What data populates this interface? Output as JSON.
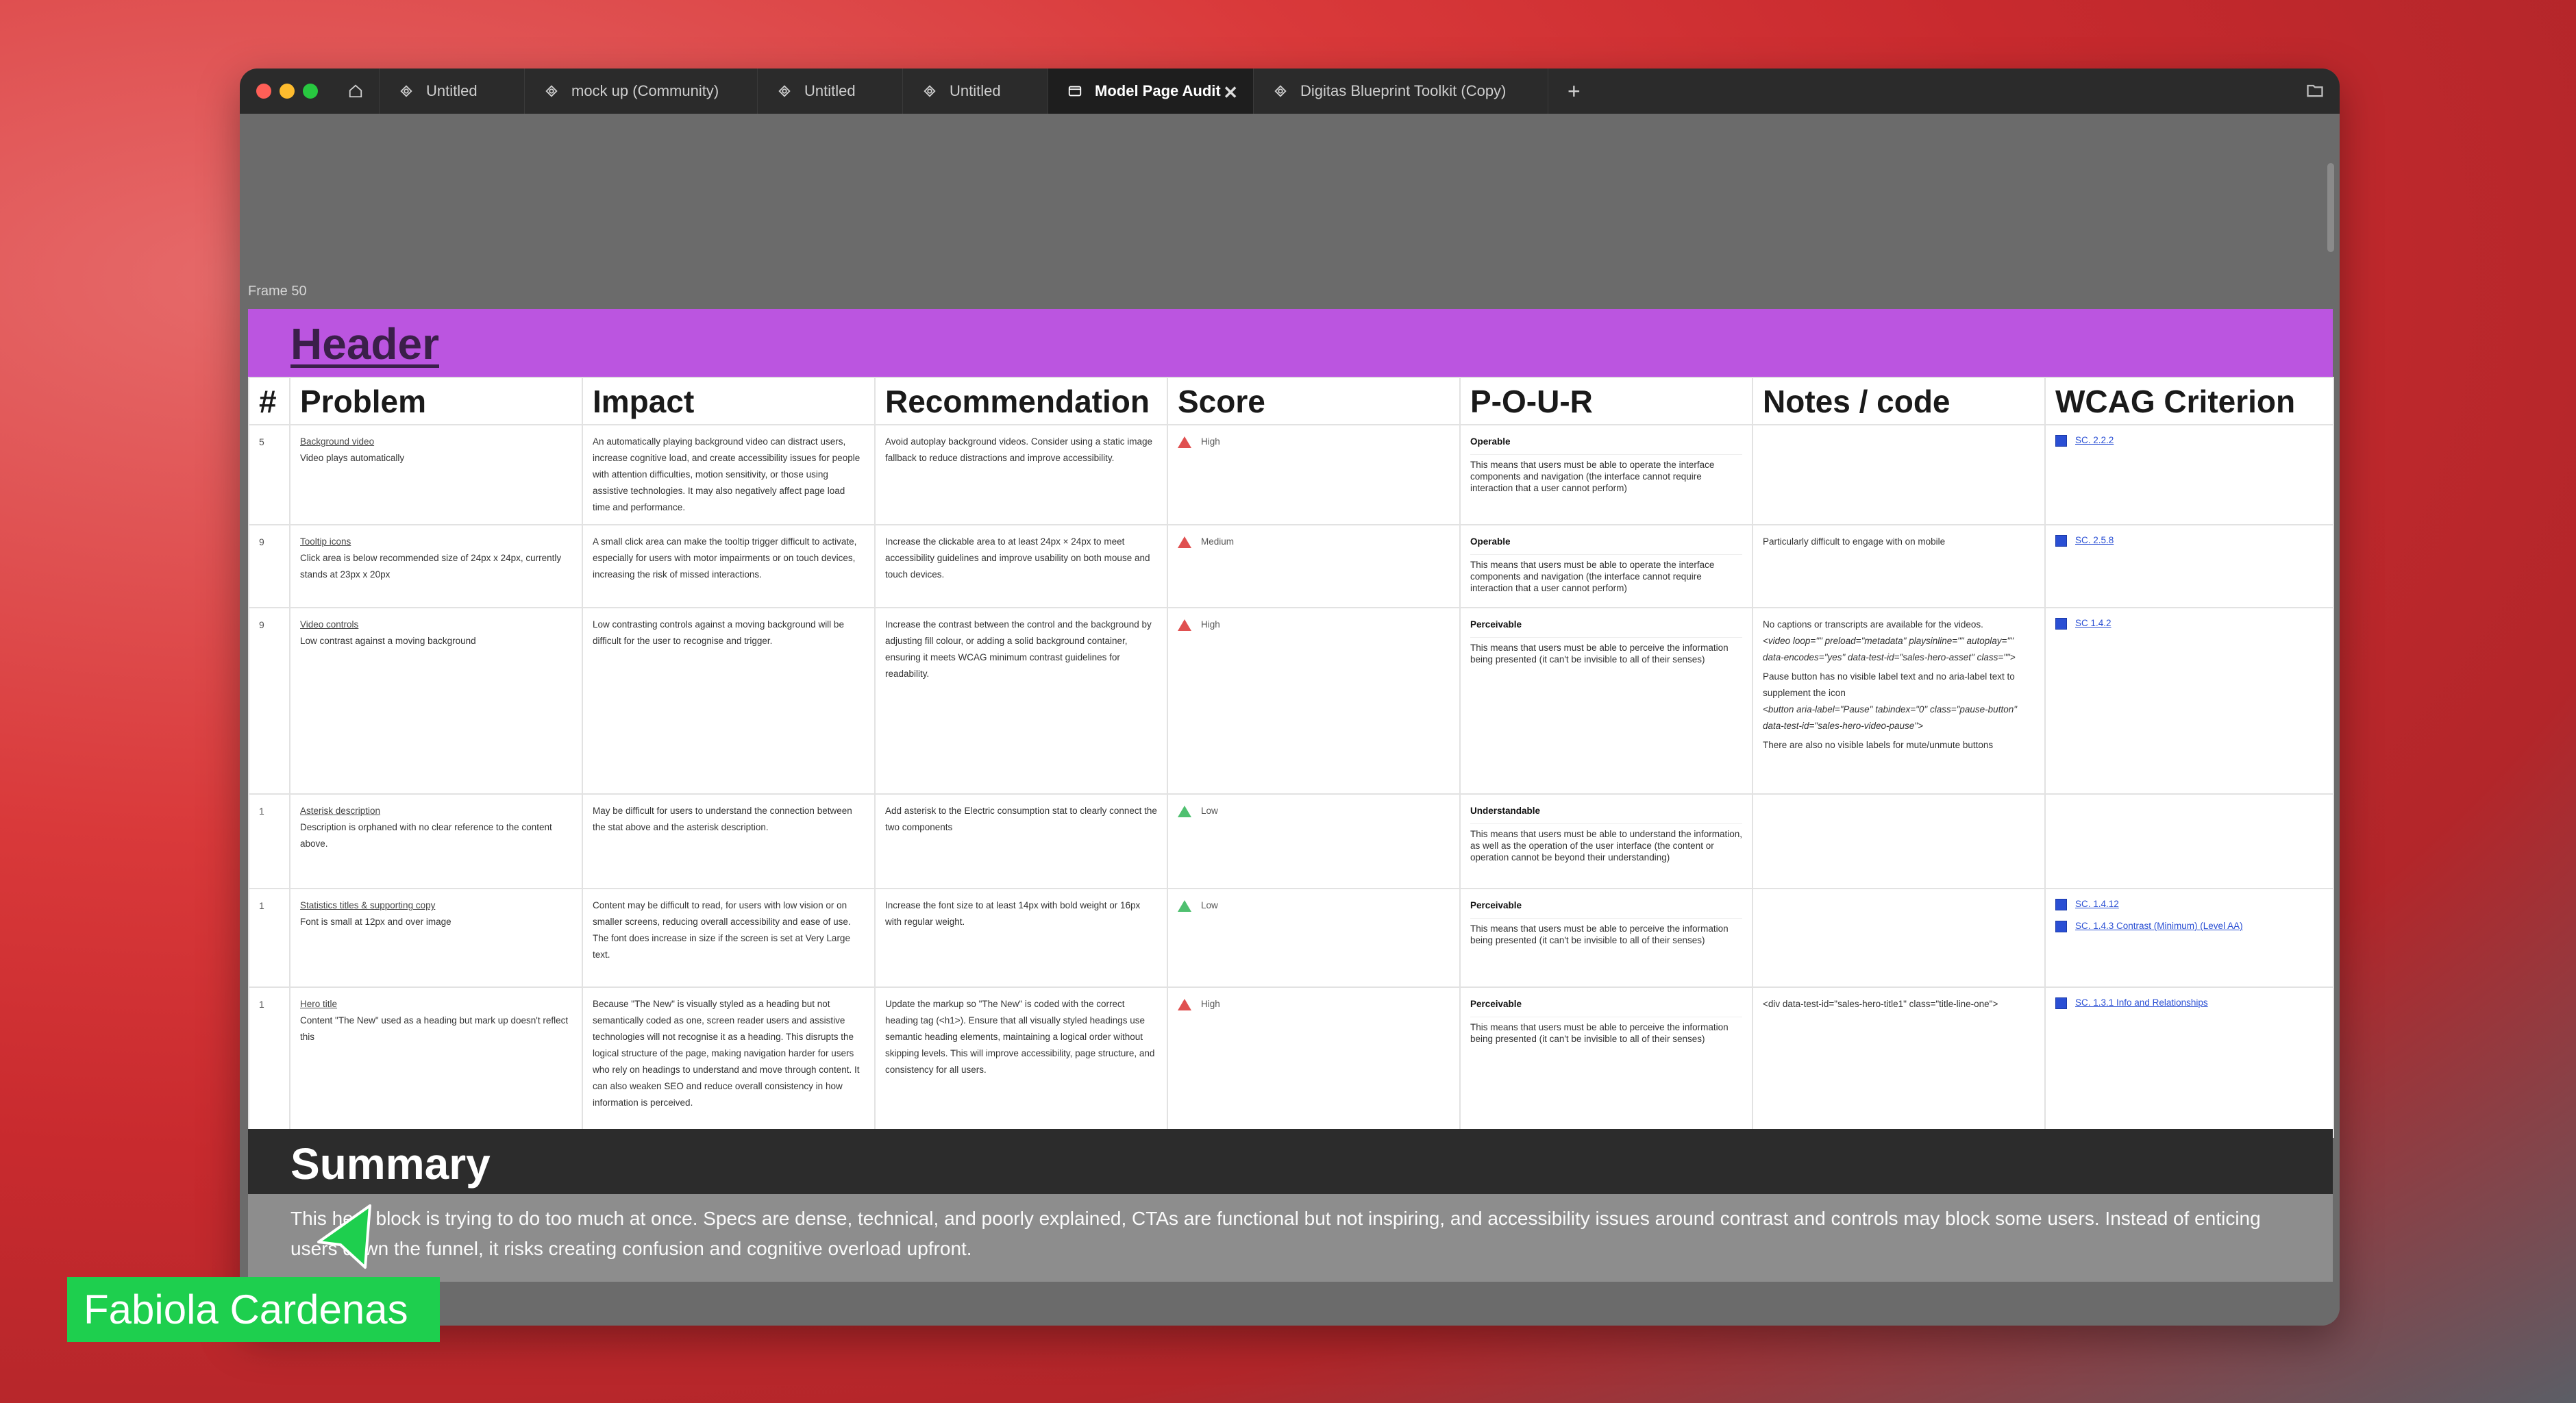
{
  "tabs": [
    {
      "label": "Untitled"
    },
    {
      "label": "mock up (Community)"
    },
    {
      "label": "Untitled"
    },
    {
      "label": "Untitled"
    },
    {
      "label": "Model Page Audit"
    },
    {
      "label": "Digitas Blueprint Toolkit (Copy)"
    }
  ],
  "add_tab": "+",
  "close_tab": "✕",
  "frame_label": "Frame 50",
  "header": {
    "title": "Header"
  },
  "columns": [
    "#",
    "Problem",
    "Impact",
    "Recommendation",
    "Score",
    "P-O-U-R",
    "Notes / code",
    "WCAG Criterion"
  ],
  "rows": [
    {
      "num": "5",
      "problem_title": "Background video",
      "problem_desc": "Video plays automatically",
      "impact": "An automatically playing background video can distract users, increase cognitive load, and create accessibility issues for people with attention difficulties, motion sensitivity, or those using assistive technologies. It may also negatively affect page load time and performance.",
      "recommendation": "Avoid autoplay background videos. Consider using a static image fallback to reduce distractions and improve accessibility.",
      "score": "High",
      "pour": "Operable",
      "pour_desc": "This means that users must be able to operate the interface components and navigation (the interface cannot require interaction that a user cannot perform)",
      "notes": "",
      "wcag": [
        "SC. 2.2.2"
      ]
    },
    {
      "num": "9",
      "problem_title": "Tooltip icons",
      "problem_desc": "Click area is below recommended size of 24px x 24px, currently stands at 23px x 20px",
      "impact": "A small click area can make the tooltip trigger difficult to activate, especially for users with motor impairments or on touch devices, increasing the risk of missed interactions.",
      "recommendation": "Increase the clickable area to at least 24px × 24px to meet accessibility guidelines and improve usability on both mouse and touch devices.",
      "score": "Medium",
      "pour": "Operable",
      "pour_desc": "This means that users must be able to operate the interface components and navigation (the interface cannot require interaction that a user cannot perform)",
      "notes": "Particularly difficult to engage with on mobile",
      "wcag": [
        "SC. 2.5.8"
      ]
    },
    {
      "num": "9",
      "problem_title": "Video controls",
      "problem_desc": "Low contrast against a moving background",
      "impact": "Low contrasting controls against a moving background will be difficult for the user to recognise and trigger.",
      "recommendation": "Increase the contrast between the control and the background by adjusting fill colour, or adding a solid background container, ensuring it meets WCAG minimum contrast guidelines for readability.",
      "score": "High",
      "pour": "Perceivable",
      "pour_desc": "This means that users must be able to perceive the information being presented (it can't be invisible to all of their senses)",
      "notes": "No captions or transcripts are available for the videos.",
      "notes_code1": "<video loop=\"\" preload=\"metadata\" playsinline=\"\" autoplay=\"\" data-encodes=\"yes\" data-test-id=\"sales-hero-asset\" class=\"\">",
      "notes2": "Pause button has no visible label text and no aria-label text to supplement the icon",
      "notes_code2": "<button aria-label=\"Pause\" tabindex=\"0\" class=\"pause-button\" data-test-id=\"sales-hero-video-pause\">",
      "notes3": "There are also no visible labels for mute/unmute buttons",
      "wcag": [
        "SC 1.4.2"
      ]
    },
    {
      "num": "1",
      "problem_title": "Asterisk description",
      "problem_desc": "Description is orphaned with no clear reference to the content above.",
      "impact": "May be difficult for users to understand the connection between the stat above and the asterisk description.",
      "recommendation": "Add asterisk to the Electric consumption stat to clearly connect the two components",
      "score": "Low",
      "pour": "Understandable",
      "pour_desc": "This means that users must be able to understand the information, as well as the operation of the user interface (the content or operation cannot be beyond their understanding)",
      "notes": "",
      "wcag": []
    },
    {
      "num": "1",
      "problem_title": "Statistics titles & supporting copy",
      "problem_desc": "Font is small at 12px and over image",
      "impact": "Content may be difficult to read, for users with low vision or on smaller screens, reducing overall accessibility and ease of use.",
      "impact2": "The font does increase in size if the screen is set at Very Large text.",
      "recommendation": "Increase the font size to at least 14px with bold weight or 16px with regular weight.",
      "score": "Low",
      "pour": "Perceivable",
      "pour_desc": "This means that users must be able to perceive the information being presented (it can't be invisible to all of their senses)",
      "notes": "",
      "wcag": [
        "SC. 1.4.12",
        "SC. 1.4.3 Contrast (Minimum) (Level AA)"
      ]
    },
    {
      "num": "1",
      "problem_title": "Hero title",
      "problem_desc": "Content \"The New\" used as a heading but mark up doesn't reflect this",
      "impact": "Because \"The New\" is visually styled as a heading but not semantically coded as one, screen reader users and assistive technologies will not recognise it as a heading. This disrupts the logical structure of the page, making navigation harder for users who rely on headings to understand and move through content. It can also weaken SEO and reduce overall consistency in how information is perceived.",
      "recommendation": "Update the markup so \"The New\" is coded with the correct heading tag (<h1>). Ensure that all visually styled headings use semantic heading elements, maintaining a logical order without skipping levels. This will improve accessibility, page structure, and consistency for all users.",
      "score": "High",
      "pour": "Perceivable",
      "pour_desc": "This means that users must be able to perceive the information being presented (it can't be invisible to all of their senses)",
      "notes": "<div data-test-id=\"sales-hero-title1\" class=\"title-line-one\">",
      "wcag": [
        "SC. 1.3.1 Info and Relationships"
      ]
    }
  ],
  "summary": {
    "title": "Summary",
    "text": "This hero block is trying to do too much at once. Specs are dense, technical, and poorly explained, CTAs are functional but not inspiring, and accessibility issues around contrast and controls may block some users. Instead of enticing users down the funnel, it risks creating confusion and cognitive overload upfront."
  },
  "collaborator": {
    "name": "Fabiola Cardenas",
    "color": "#1ecf4e"
  },
  "colors": {
    "header": "#bb55e0",
    "summary": "#2c2c2c",
    "high": "#e05050",
    "low": "#4fc070",
    "link": "#2a4fd4"
  }
}
